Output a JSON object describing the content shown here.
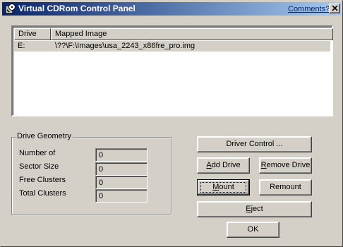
{
  "window": {
    "title": "Virtual CDRom Control Panel",
    "comments_link": "Comments?"
  },
  "list": {
    "columns": [
      "Drive",
      "Mapped Image"
    ],
    "rows": [
      {
        "drive": "E:",
        "image": "\\??\\F:\\Images\\usa_2243_x86fre_pro.img"
      }
    ]
  },
  "geometry": {
    "title": "Drive Geometry",
    "fields": [
      {
        "label": "Number of",
        "value": "0"
      },
      {
        "label": "Sector Size",
        "value": "0"
      },
      {
        "label": "Free Clusters",
        "value": "0"
      },
      {
        "label": "Total Clusters",
        "value": "0"
      }
    ]
  },
  "buttons": {
    "driver_control": "Driver Control ...",
    "add_drive_prefix": "A",
    "add_drive_rest": "dd Drive",
    "remove_drive_prefix": "R",
    "remove_drive_rest": "emove Drive",
    "mount_prefix": "M",
    "mount_rest": "ount",
    "remount": "Remount",
    "eject_prefix": "E",
    "eject_rest": "ject",
    "ok": "OK"
  },
  "colors": {
    "titlebar_start": "#0a246a",
    "titlebar_end": "#a6caf0",
    "face": "#d4d0c8"
  }
}
